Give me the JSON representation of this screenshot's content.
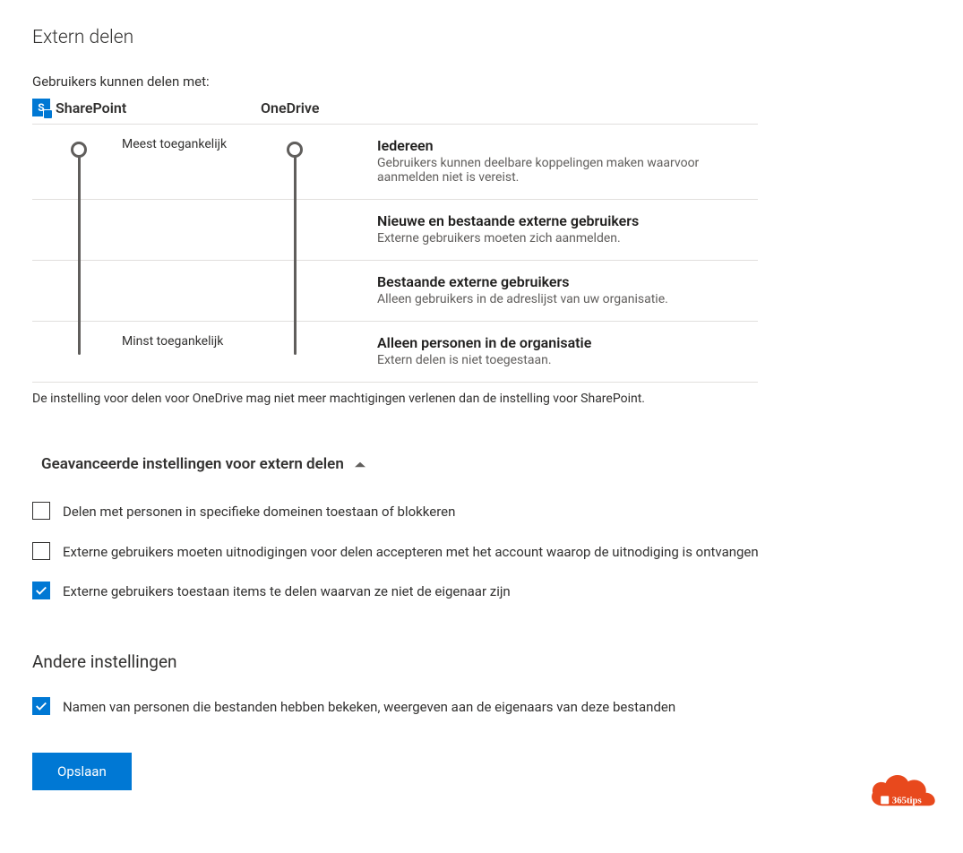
{
  "title": "Extern delen",
  "shareWithLabel": "Gebruikers kunnen delen met:",
  "columns": {
    "sharepoint": "SharePoint",
    "onedrive": "OneDrive"
  },
  "hints": {
    "most": "Meest toegankelijk",
    "least": "Minst toegankelijk"
  },
  "levels": [
    {
      "title": "Iedereen",
      "sub": "Gebruikers kunnen deelbare koppelingen maken waarvoor aanmelden niet is vereist."
    },
    {
      "title": "Nieuwe en bestaande externe gebruikers",
      "sub": "Externe gebruikers moeten zich aanmelden."
    },
    {
      "title": "Bestaande externe gebruikers",
      "sub": "Alleen gebruikers in de adreslijst van uw organisatie."
    },
    {
      "title": "Alleen personen in de organisatie",
      "sub": "Extern delen is niet toegestaan."
    }
  ],
  "note": "De instelling voor delen voor OneDrive mag niet meer machtigingen verlenen dan de instelling voor SharePoint.",
  "advancedHeader": "Geavanceerde instellingen voor extern delen",
  "advanced": [
    {
      "checked": false,
      "label": "Delen met personen in specifieke domeinen toestaan of blokkeren"
    },
    {
      "checked": false,
      "label": "Externe gebruikers moeten uitnodigingen voor delen accepteren met het account waarop de uitnodiging is ontvangen"
    },
    {
      "checked": true,
      "label": "Externe gebruikers toestaan items te delen waarvan ze niet de eigenaar zijn"
    }
  ],
  "otherHeader": "Andere instellingen",
  "other": [
    {
      "checked": true,
      "label": "Namen van personen die bestanden hebben bekeken, weergeven aan de eigenaars van deze bestanden"
    }
  ],
  "save": "Opslaan",
  "watermark": "365tips"
}
